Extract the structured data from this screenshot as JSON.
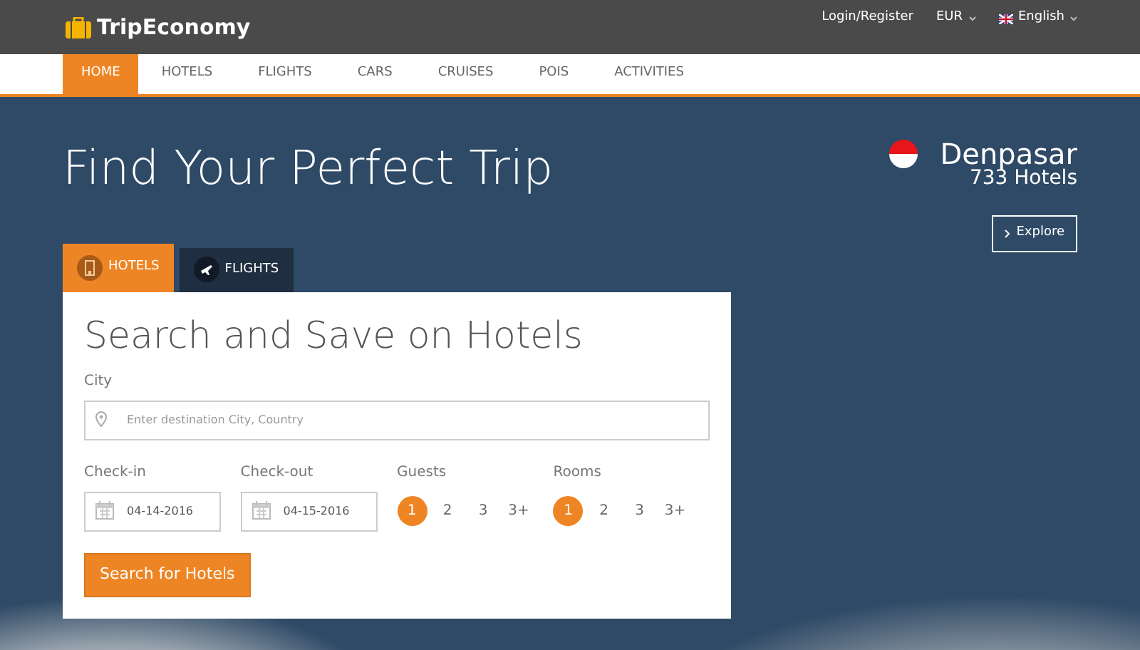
{
  "header": {
    "logo": "TripEconomy",
    "login": "Login/Register",
    "currency": "EUR",
    "language": "English"
  },
  "nav": [
    {
      "label": "HOME",
      "selected": true
    },
    {
      "label": "HOTELS",
      "selected": false
    },
    {
      "label": "FLIGHTS",
      "selected": false
    },
    {
      "label": "CARS",
      "selected": false
    },
    {
      "label": "CRUISES",
      "selected": false
    },
    {
      "label": "POIS",
      "selected": false
    },
    {
      "label": "ACTIVITIES",
      "selected": false
    }
  ],
  "hero": {
    "title": "Find Your Perfect Trip",
    "destination": {
      "name": "Denpasar",
      "count": "733 Hotels",
      "button": "Explore"
    }
  },
  "tabs": [
    {
      "label": "HOTELS",
      "kind": "hotel",
      "selected": true
    },
    {
      "label": "FLIGHTS",
      "kind": "flight",
      "selected": false
    }
  ],
  "form": {
    "title": "Search and Save on Hotels",
    "city": {
      "label": "City",
      "placeholder": "Enter destination City, Country"
    },
    "checkin": {
      "label": "Check-in",
      "value": "04-14-2016"
    },
    "checkout": {
      "label": "Check-out",
      "value": "04-15-2016"
    },
    "pickers": [
      {
        "label": "Guests",
        "options": [
          {
            "label": "1",
            "selected": true
          },
          {
            "label": "2",
            "selected": false
          },
          {
            "label": "3",
            "selected": false
          },
          {
            "label": "3+",
            "selected": false
          }
        ]
      },
      {
        "label": "Rooms",
        "options": [
          {
            "label": "1",
            "selected": true
          },
          {
            "label": "2",
            "selected": false
          },
          {
            "label": "3",
            "selected": false
          },
          {
            "label": "3+",
            "selected": false
          }
        ]
      }
    ],
    "button": "Search for Hotels"
  }
}
